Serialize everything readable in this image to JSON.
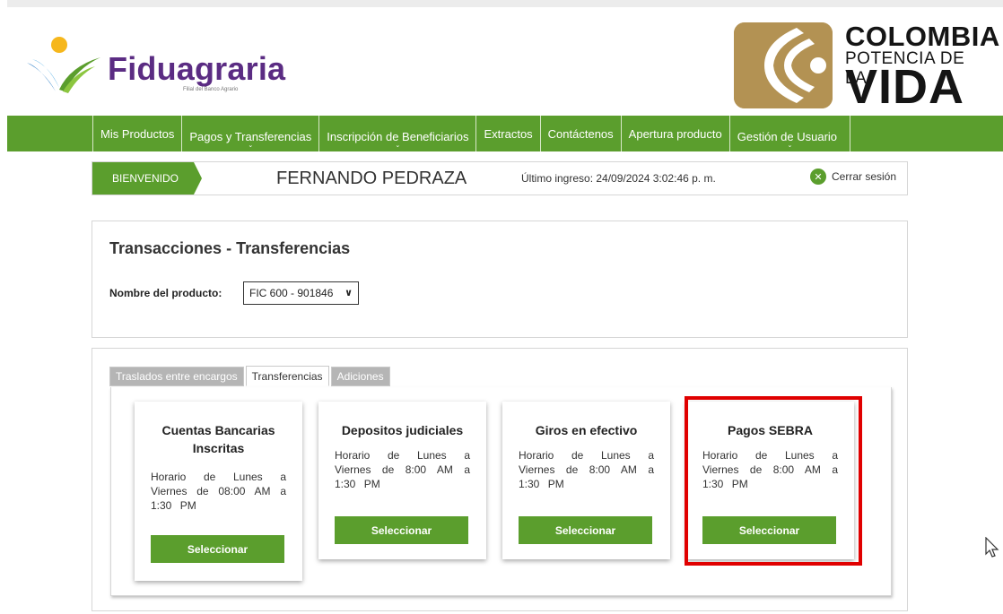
{
  "brand": {
    "name": "Fiduagraria",
    "tagline": "Filial del Banco Agrario",
    "gov_line1": "COLOMBIA",
    "gov_line2": "POTENCIA DE LA",
    "gov_line3": "VIDA"
  },
  "nav": {
    "items": [
      {
        "label": "Mis Productos",
        "has_caret": false
      },
      {
        "label": "Pagos y Transferencias",
        "has_caret": true
      },
      {
        "label": "Inscripción de Beneficiarios",
        "has_caret": true
      },
      {
        "label": "Extractos",
        "has_caret": false
      },
      {
        "label": "Contáctenos",
        "has_caret": false
      },
      {
        "label": "Apertura producto",
        "has_caret": false
      },
      {
        "label": "Gestión de Usuario",
        "has_caret": true
      }
    ]
  },
  "welcome": {
    "badge": "BIENVENIDO",
    "user": "FERNANDO PEDRAZA",
    "last_login": "Último ingreso: 24/09/2024 3:02:46 p. m.",
    "logout": "Cerrar sesión"
  },
  "transactions": {
    "title": "Transacciones - Transferencias",
    "product_label": "Nombre del producto:",
    "product_value": "FIC 600 - 901846"
  },
  "tabs": [
    {
      "label": "Traslados entre encargos",
      "active": false
    },
    {
      "label": "Transferencias",
      "active": true
    },
    {
      "label": "Adiciones",
      "active": false
    }
  ],
  "cards": [
    {
      "title": "Cuentas Bancarias Inscritas",
      "text": "Horario de Lunes a Viernes de 08:00 AM a 1:30 PM",
      "button": "Seleccionar"
    },
    {
      "title": "Depositos judiciales",
      "text": "Horario de Lunes a Viernes de 8:00 AM a 1:30 PM",
      "button": "Seleccionar"
    },
    {
      "title": "Giros en efectivo",
      "text": "Horario de Lunes a Viernes de 8:00 AM a 1:30 PM",
      "button": "Seleccionar"
    },
    {
      "title": "Pagos SEBRA",
      "text": "Horario de Lunes a Viernes de 8:00 AM a 1:30 PM",
      "button": "Seleccionar"
    }
  ],
  "colors": {
    "primary_green": "#5b9e2d",
    "brand_purple": "#5b2c83",
    "gov_gold": "#b39253",
    "highlight_red": "#e00000"
  }
}
